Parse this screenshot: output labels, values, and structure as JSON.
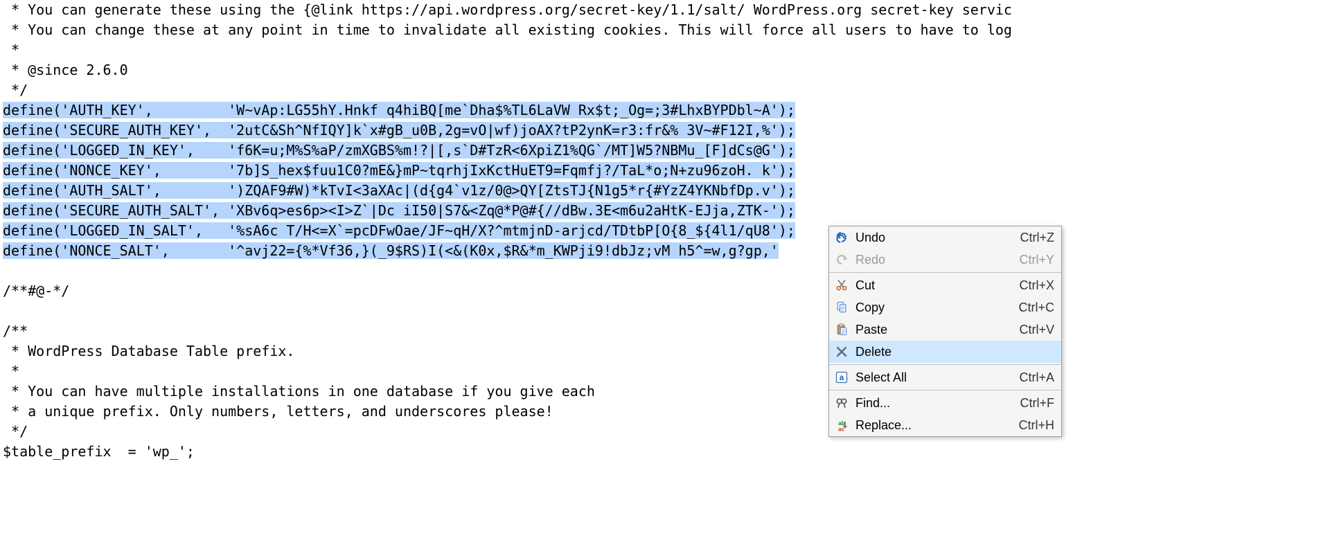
{
  "code": {
    "pre": [
      " * You can generate these using the {@link https://api.wordpress.org/secret-key/1.1/salt/ WordPress.org secret-key servic",
      " * You can change these at any point in time to invalidate all existing cookies. This will force all users to have to log",
      " *",
      " * @since 2.6.0",
      " */"
    ],
    "selected": [
      "define('AUTH_KEY',         'W~vAp:LG55hY.Hnkf q4hiBQ[me`Dha$%TL6LaVW Rx$t;_Og=;3#LhxBYPDbl~A');",
      "define('SECURE_AUTH_KEY',  '2utC&Sh^NfIQY]k`x#gB_u0B,2g=vO|wf)joAX?tP2ynK=r3:fr&% 3V~#F12I,%');",
      "define('LOGGED_IN_KEY',    'f6K=u;M%S%aP/zmXGBS%m!?|[,s`D#TzR<6XpiZ1%QG`/MT]W5?NBMu_[F]dCs@G');",
      "define('NONCE_KEY',        '7b]S_hex$fuu1C0?mE&}mP~tqrhjIxKctHuET9=Fqmfj?/TaL*o;N+zu96zoH. k');",
      "define('AUTH_SALT',        ')ZQAF9#W)*kTvI<3aXAc|(d{g4`v1z/0@>QY[ZtsTJ{N1g5*r{#YzZ4YKNbfDp.v');",
      "define('SECURE_AUTH_SALT', 'XBv6q>es6p><I>Z`|Dc iI50|S7&<Zq@*P@#{//dBw.3E<m6u2aHtK-EJja,ZTK-');",
      "define('LOGGED_IN_SALT',   '%sA6c T/H<=X`=pcDFwOae/JF~qH/X?^mtmjnD-arjcd/TDtbP[O{8_${4l1/qU8');",
      "define('NONCE_SALT',       '^avj22={%*Vf36,}(_9$RS)I(<&(K0x,$R&*m_KWPji9!dbJz;vM h5^=w,g?gp,'"
    ],
    "post": [
      "",
      "/**#@-*/",
      "",
      "/**",
      " * WordPress Database Table prefix.",
      " *",
      " * You can have multiple installations in one database if you give each",
      " * a unique prefix. Only numbers, letters, and underscores please!",
      " */",
      "$table_prefix  = 'wp_';"
    ]
  },
  "menu": {
    "undo": {
      "label": "Undo",
      "shortcut": "Ctrl+Z"
    },
    "redo": {
      "label": "Redo",
      "shortcut": "Ctrl+Y"
    },
    "cut": {
      "label": "Cut",
      "shortcut": "Ctrl+X"
    },
    "copy": {
      "label": "Copy",
      "shortcut": "Ctrl+C"
    },
    "paste": {
      "label": "Paste",
      "shortcut": "Ctrl+V"
    },
    "delete": {
      "label": "Delete",
      "shortcut": ""
    },
    "selectall": {
      "label": "Select All",
      "shortcut": "Ctrl+A"
    },
    "find": {
      "label": "Find...",
      "shortcut": "Ctrl+F"
    },
    "replace": {
      "label": "Replace...",
      "shortcut": "Ctrl+H"
    }
  }
}
